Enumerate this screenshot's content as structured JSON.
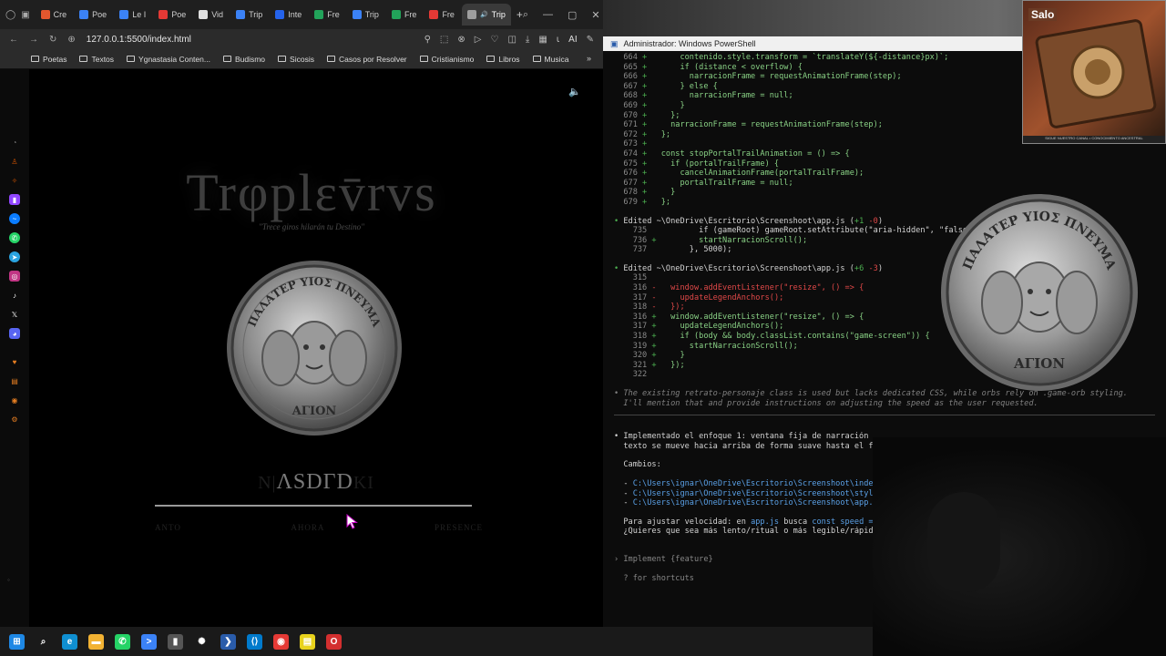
{
  "browser": {
    "tabs": [
      {
        "label": "Cre",
        "color": "#e4572e"
      },
      {
        "label": "Poe",
        "color": "#3b82f6"
      },
      {
        "label": "Le I",
        "color": "#3b82f6"
      },
      {
        "label": "Poe",
        "color": "#e53935"
      },
      {
        "label": "Vid",
        "color": "#e0e0e0"
      },
      {
        "label": "Trip",
        "color": "#3b82f6"
      },
      {
        "label": "Inte",
        "color": "#2563eb"
      },
      {
        "label": "Fre",
        "color": "#22a35a"
      },
      {
        "label": "Trip",
        "color": "#3b82f6"
      },
      {
        "label": "Fre",
        "color": "#22a35a"
      },
      {
        "label": "Fre",
        "color": "#e53935"
      },
      {
        "label": "Trip",
        "color": "#9e9e9e",
        "active": true
      }
    ],
    "new_tab": "+",
    "url": "127.0.0.1:5500/index.html",
    "ai_label": "AI",
    "bookmarks": [
      "Poetas",
      "Textos",
      "Ygnastasia Conten...",
      "Budismo",
      "Sicosis",
      "Casos por Resolver",
      "Cristianismo",
      "Libros",
      "Musica"
    ]
  },
  "game": {
    "title": "Trφplεv̄rvs",
    "tagline": "\"Trece giros hilarán tu Destino\"",
    "coin_top_text": "ΠΑΛΑΤΕΡ ΥΙΟΣ ΠΝΕΥΜΑ",
    "coin_bottom_text": "ΑΓΙΟΝ",
    "cta_text": "ΛSDΓD",
    "cta_ghost_left": "Ν|",
    "cta_ghost_right": "ΚΙ",
    "labels": [
      "ANTO",
      "AHORA",
      "PRESENCE"
    ]
  },
  "terminal": {
    "title": "Administrador: Windows PowerShell",
    "block1": [
      {
        "n": "664",
        "t": "      contenido.style.transform = `translateY(${-distance}px)`;"
      },
      {
        "n": "665",
        "t": "      if (distance < overflow) {"
      },
      {
        "n": "666",
        "t": "        narracionFrame = requestAnimationFrame(step);"
      },
      {
        "n": "667",
        "t": "      } else {"
      },
      {
        "n": "668",
        "t": "        narracionFrame = null;"
      },
      {
        "n": "669",
        "t": "      }"
      },
      {
        "n": "670",
        "t": "    };"
      },
      {
        "n": "671",
        "t": "    narracionFrame = requestAnimationFrame(step);"
      },
      {
        "n": "672",
        "t": "  };"
      },
      {
        "n": "673",
        "t": ""
      },
      {
        "n": "674",
        "t": "  const stopPortalTrailAnimation = () => {"
      },
      {
        "n": "675",
        "t": "    if (portalTrailFrame) {"
      },
      {
        "n": "676",
        "t": "      cancelAnimationFrame(portalTrailFrame);"
      },
      {
        "n": "677",
        "t": "      portalTrailFrame = null;"
      },
      {
        "n": "678",
        "t": "    }"
      },
      {
        "n": "679",
        "t": "  };"
      }
    ],
    "edit1": {
      "path": "Edited ~\\OneDrive\\Escritorio\\Screenshoot\\app.js",
      "plus": "+1",
      "minus": "-0"
    },
    "block2": [
      {
        "n": "735",
        "sign": " ",
        "t": "        if (gameRoot) gameRoot.setAttribute(\"aria-hidden\", \"false\");"
      },
      {
        "n": "736",
        "sign": "+",
        "t": "        startNarracionScroll();"
      },
      {
        "n": "737",
        "sign": " ",
        "t": "      }, 5000);"
      }
    ],
    "edit2": {
      "path": "Edited ~\\OneDrive\\Escritorio\\Screenshoot\\app.js",
      "plus": "+6",
      "minus": "-3"
    },
    "block3": [
      {
        "n": "315",
        "sign": " ",
        "t": ""
      },
      {
        "n": "316",
        "sign": "-",
        "t": "  window.addEventListener(\"resize\", () => {"
      },
      {
        "n": "317",
        "sign": "-",
        "t": "    updateLegendAnchors();"
      },
      {
        "n": "318",
        "sign": "-",
        "t": "  });"
      },
      {
        "n": "316",
        "sign": "+",
        "t": "  window.addEventListener(\"resize\", () => {"
      },
      {
        "n": "317",
        "sign": "+",
        "t": "    updateLegendAnchors();"
      },
      {
        "n": "318",
        "sign": "+",
        "t": "    if (body && body.classList.contains(\"game-screen\")) {"
      },
      {
        "n": "319",
        "sign": "+",
        "t": "      startNarracionScroll();"
      },
      {
        "n": "320",
        "sign": "+",
        "t": "    }"
      },
      {
        "n": "321",
        "sign": "+",
        "t": "  });"
      },
      {
        "n": "322",
        "sign": " ",
        "t": ""
      }
    ],
    "note1": "The existing retrato-personaje class is used but lacks dedicated CSS, while orbs rely on .game-orb styling.",
    "note2": "I'll mention that and provide instructions on adjusting the speed as the user requested.",
    "summary1": "Implementado el enfoque 1: ventana fija de narración",
    "summary2": "texto se mueve hacia arriba de forma suave hasta el f",
    "changes_label": "Cambios:",
    "changes": [
      "C:\\Users\\ignar\\OneDrive\\Escritorio\\Screenshoot\\inde",
      "C:\\Users\\ignar\\OneDrive\\Escritorio\\Screenshoot\\styl",
      "C:\\Users\\ignar\\OneDrive\\Escritorio\\Screenshoot\\app."
    ],
    "speed_pre": "Para ajustar velocidad: en ",
    "speed_file": "app.js",
    "speed_mid": " busca ",
    "speed_code": "const speed =",
    "question": "¿Quieres que sea más lento/ritual o más legible/rápid",
    "prompt_hint": "Implement {feature}",
    "shortcuts": "? for shortcuts"
  },
  "overlay": {
    "stream_tag": "Salo",
    "stream_footer": "SIGUE NUESTRO CANAL • CONOCIMIENTO ANCESTRAL"
  },
  "taskbar": {
    "apps": [
      {
        "name": "windows-start",
        "color": "#1e88e5",
        "glyph": "⊞"
      },
      {
        "name": "search",
        "color": "#1a1a1a",
        "glyph": "⌕"
      },
      {
        "name": "edge",
        "color": "#0f8fd1",
        "glyph": "e"
      },
      {
        "name": "file-explorer",
        "color": "#f2b233",
        "glyph": "▬"
      },
      {
        "name": "whatsapp",
        "color": "#25d366",
        "glyph": "✆"
      },
      {
        "name": "terminal",
        "color": "#3b82f6",
        "glyph": ">"
      },
      {
        "name": "phone",
        "color": "#555555",
        "glyph": "▮"
      },
      {
        "name": "chatgpt",
        "color": "#1a1a1a",
        "glyph": "✺"
      },
      {
        "name": "powershell",
        "color": "#2a5caa",
        "glyph": "❯"
      },
      {
        "name": "vscode",
        "color": "#007acc",
        "glyph": "⟨⟩"
      },
      {
        "name": "chrome",
        "color": "#e53935",
        "glyph": "◉"
      },
      {
        "name": "notes",
        "color": "#e8d21c",
        "glyph": "▤"
      },
      {
        "name": "opera",
        "color": "#d32f2f",
        "glyph": "O"
      }
    ]
  }
}
